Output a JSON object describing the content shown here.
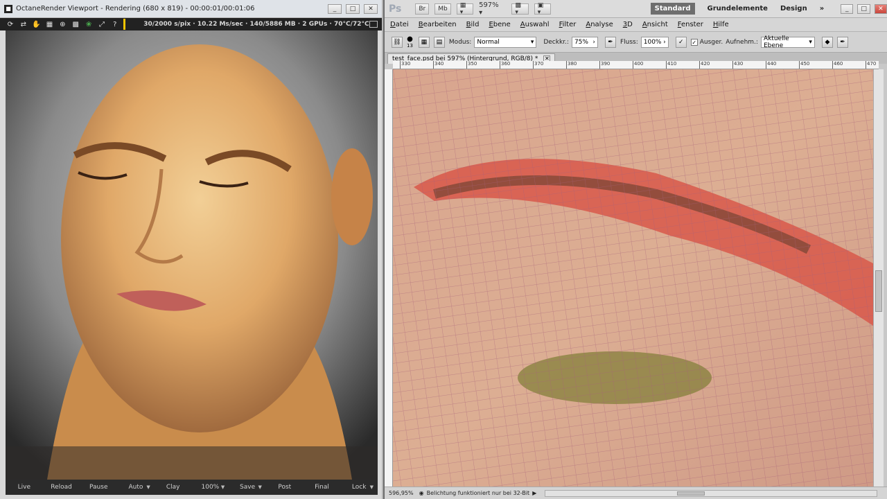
{
  "octane": {
    "title": "OctaneRender Viewport - Rendering (680 x 819) - 00:00:01/00:01:06",
    "status": "30/2000 s/pix · 10.22 Ms/sec · 140/5886 MB · 2 GPUs · 70°C/72°C",
    "toolbar_icons": [
      "refresh-icon",
      "arrows-icon",
      "hand-icon",
      "film-icon",
      "target-icon",
      "grid-icon",
      "rgb-icon",
      "expand-icon",
      "help-icon"
    ],
    "bottom_buttons": [
      {
        "label": "Live",
        "dropdown": false
      },
      {
        "label": "Reload",
        "dropdown": false
      },
      {
        "label": "Pause",
        "dropdown": false
      },
      {
        "label": "Auto",
        "dropdown": true
      },
      {
        "label": "Clay",
        "dropdown": false
      },
      {
        "label": "100%",
        "dropdown": true
      },
      {
        "label": "Save",
        "dropdown": true
      },
      {
        "label": "Post",
        "dropdown": false
      },
      {
        "label": "Final",
        "dropdown": false
      },
      {
        "label": "Lock",
        "dropdown": true
      }
    ],
    "window_buttons": [
      "_",
      "□",
      "✕"
    ]
  },
  "photoshop": {
    "logo": "Ps",
    "top_buttons": [
      "Br",
      "Mb"
    ],
    "zoom": "597%",
    "workspaces": [
      {
        "label": "Standard",
        "active": true
      },
      {
        "label": "Grundelemente",
        "active": false
      },
      {
        "label": "Design",
        "active": false
      }
    ],
    "more": "»",
    "menu": [
      {
        "first": "D",
        "rest": "atei"
      },
      {
        "first": "B",
        "rest": "earbeiten"
      },
      {
        "first": "B",
        "rest": "ild"
      },
      {
        "first": "E",
        "rest": "bene"
      },
      {
        "first": "A",
        "rest": "uswahl"
      },
      {
        "first": "F",
        "rest": "ilter"
      },
      {
        "first": "A",
        "rest": "nalyse"
      },
      {
        "first": "3",
        "rest": "D"
      },
      {
        "first": "A",
        "rest": "nsicht"
      },
      {
        "first": "F",
        "rest": "enster"
      },
      {
        "first": "H",
        "rest": "ilfe"
      }
    ],
    "options": {
      "brush_size": "13",
      "mode_label": "Modus:",
      "mode_value": "Normal",
      "opacity_label": "Deckkr.:",
      "opacity_value": "75%",
      "flow_label": "Fluss:",
      "flow_value": "100%",
      "aligned_label": "Ausger.",
      "sample_label": "Aufnehm.:",
      "sample_value": "Aktuelle Ebene"
    },
    "doc_tab": "test_face.psd bei 597% (Hintergrund, RGB/8) *",
    "ruler_ticks": [
      "330",
      "340",
      "350",
      "360",
      "370",
      "380",
      "390",
      "400",
      "410",
      "420",
      "430",
      "440",
      "450",
      "460",
      "470"
    ],
    "status_zoom": "596,95%",
    "status_info": "Belichtung funktioniert nur bei 32-Bit"
  },
  "colors": {
    "octane_toolbar": "#222222",
    "accent_bar": "#f5c400",
    "ps_active_workspace": "#6e6e6e"
  }
}
